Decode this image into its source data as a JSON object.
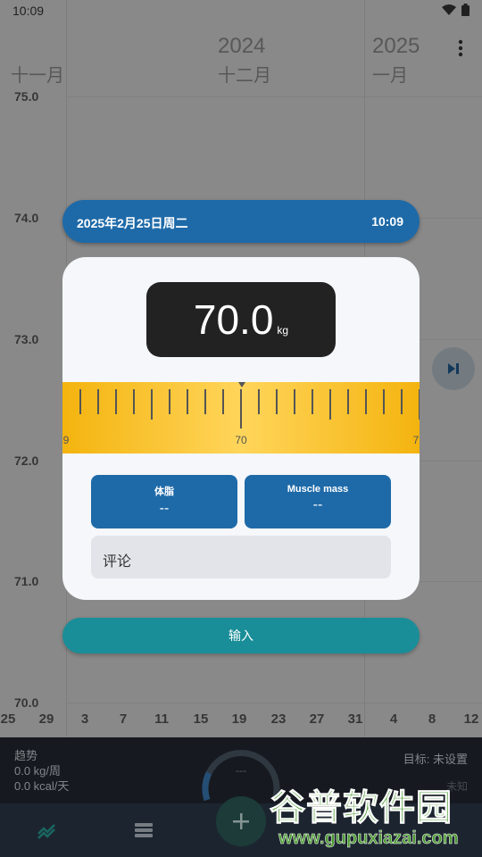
{
  "status_bar": {
    "time": "10:09"
  },
  "chart": {
    "years": [
      "2024",
      "2025"
    ],
    "months": [
      "十一月",
      "十二月",
      "一月"
    ],
    "y_labels": [
      "75.0",
      "74.0",
      "73.0",
      "72.0",
      "71.0",
      "70.0"
    ],
    "x_labels": [
      "25",
      "29",
      "3",
      "7",
      "11",
      "15",
      "19",
      "23",
      "27",
      "31",
      "4",
      "8",
      "12"
    ]
  },
  "dialog": {
    "date": "2025年2月25日周二",
    "time": "10:09",
    "weight_value": "70.0",
    "weight_unit": "kg",
    "ruler_labels": [
      "9",
      "70",
      "7"
    ],
    "body_fat_label": "体脂",
    "body_fat_value": "--",
    "muscle_label": "Muscle mass",
    "muscle_value": "--",
    "comment_placeholder": "评论",
    "submit_label": "输入"
  },
  "trend": {
    "title": "趋势",
    "rate_weight": "0.0 kg/周",
    "rate_kcal": "0.0 kcal/天",
    "goal": "目标: 未设置",
    "gauge_value": "---",
    "unknown": "未知"
  },
  "watermark": {
    "cn": "谷普软件园",
    "en": "www.gupuxiazai.com"
  },
  "colors": {
    "primary": "#1e6aa8",
    "accent": "#1a8e98",
    "ruler": "#f4b40f"
  }
}
